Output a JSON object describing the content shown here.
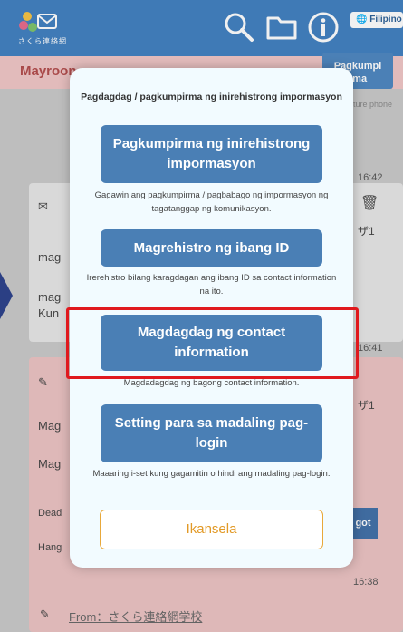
{
  "header": {
    "logo_text": "さくら連絡網",
    "language_label": "Filipino",
    "icons": [
      "search-icon",
      "folder-icon",
      "info-icon"
    ]
  },
  "background": {
    "tab_label": "Mayroon",
    "confirm_tab_label": "Pagkumpi\nrma",
    "feature_text": "ature phone",
    "times": [
      "16:42",
      "16:41",
      "16:38"
    ],
    "card1": {
      "line1": "mag",
      "line2": "mag",
      "line3": "Kun",
      "right": "ザ1"
    },
    "card2": {
      "line1": "Mag",
      "line2": "Mag",
      "line3": "Dead",
      "line4": "Hang",
      "right": "ザ1",
      "got": "got"
    },
    "card3": {
      "from": "From：さくら連絡網学校"
    }
  },
  "dialog": {
    "title": "Pagdagdag / pagkumpirma ng inirehistrong impormasyon",
    "actions": [
      {
        "label": "Pagkumpirma ng inirehistrong impormasyon",
        "desc": "Gagawin ang pagkumpirma / pagbabago ng impormasyon ng tagatanggap ng komunikasyon."
      },
      {
        "label": "Magrehistro ng ibang ID",
        "desc": "Irerehistro bilang karagdagan ang ibang ID sa contact information na ito."
      },
      {
        "label": "Magdagdag ng contact information",
        "desc": "Magdadagdag ng bagong contact information."
      },
      {
        "label": "Setting para sa madaling pag-login",
        "desc": "Maaaring i-set kung gagamitin o hindi ang madaling pag-login."
      }
    ],
    "cancel_label": "Ikansela"
  },
  "colors": {
    "appbar": "#3f7fc1",
    "button": "#4a7fb5",
    "highlight": "#e0191e",
    "cancel": "#e29a27"
  }
}
